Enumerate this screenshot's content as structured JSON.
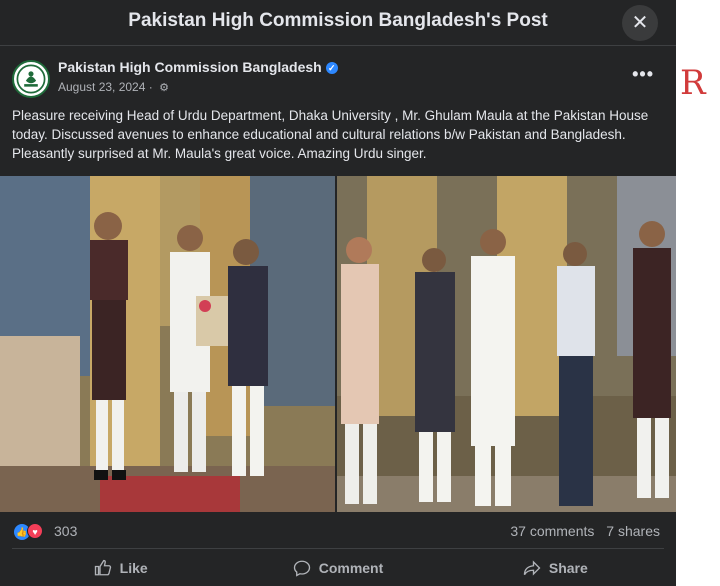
{
  "dialog": {
    "title": "Pakistan High Commission Bangladesh's Post",
    "close_icon": "close-icon"
  },
  "post": {
    "page_name": "Pakistan High Commission Bangladesh",
    "date": "August 23, 2024",
    "separator": "·",
    "text": "Pleasure receiving Head of Urdu Department, Dhaka University , Mr. Ghulam Maula at the Pakistan House today. Discussed avenues to enhance educational and cultural relations b/w Pakistan and Bangladesh. Pleasantly surprised at Mr. Maula's great voice. Amazing Urdu singer.",
    "photos": [
      {
        "name": "photo-presentation"
      },
      {
        "name": "photo-group"
      }
    ]
  },
  "reactions": {
    "count": "303",
    "comments": "37 comments",
    "shares": "7 shares"
  },
  "actions": {
    "like": "Like",
    "comment": "Comment",
    "share": "Share"
  },
  "colors": {
    "background": "#242526",
    "text": "#e4e6eb",
    "secondary_text": "#b0b3b8",
    "like_blue": "#2d88ff",
    "love_red": "#f33e58",
    "annotation_red": "#d13b3b"
  },
  "annotation": {
    "mark": "R"
  }
}
